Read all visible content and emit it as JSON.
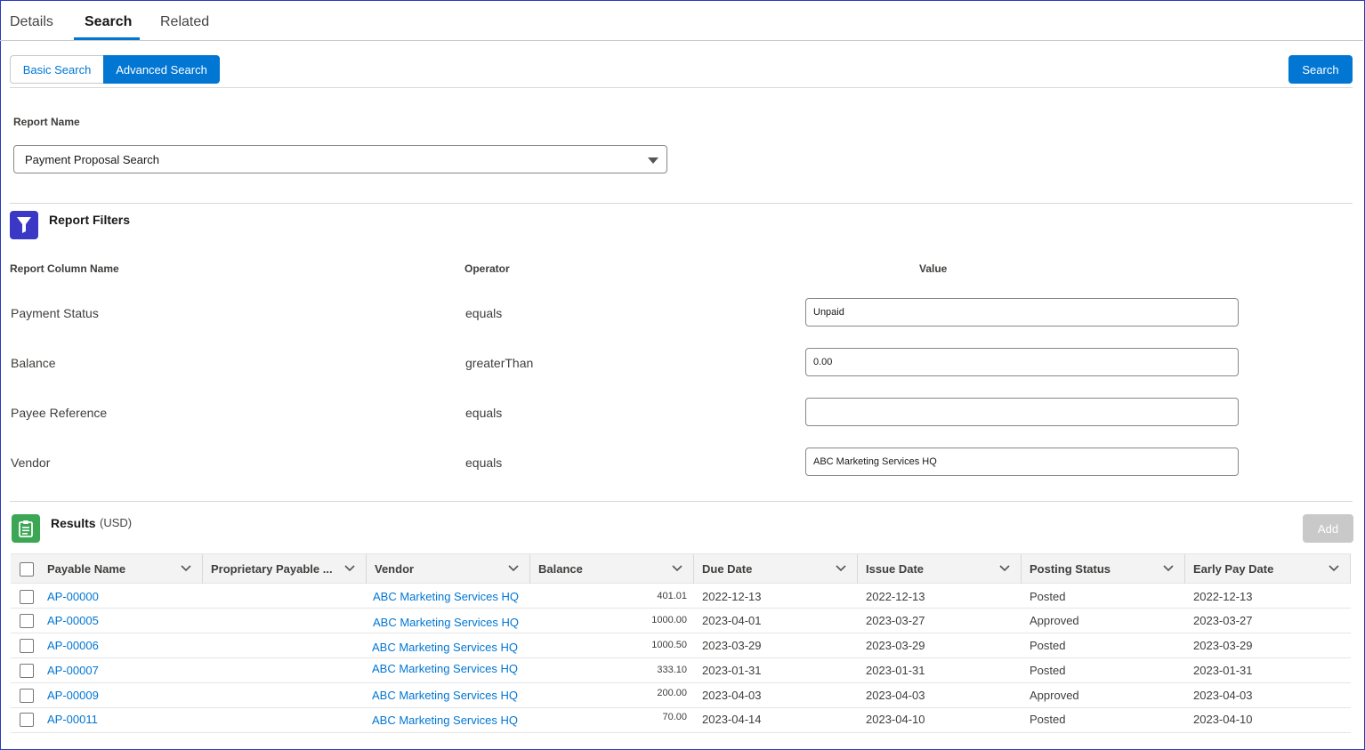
{
  "tabs": [
    {
      "label": "Details"
    },
    {
      "label": "Search"
    },
    {
      "label": "Related"
    }
  ],
  "search_mode": {
    "basic_label": "Basic Search",
    "advanced_label": "Advanced Search",
    "selected": "Advanced Search"
  },
  "search_button_label": "Search",
  "report_name": {
    "label": "Report Name",
    "selected_value": "Payment Proposal Search"
  },
  "filters": {
    "title": "Report Filters",
    "col_name_header": "Report Column Name",
    "operator_header": "Operator",
    "value_header": "Value",
    "rows": [
      {
        "column": "Payment Status",
        "operator": "equals",
        "value": "Unpaid"
      },
      {
        "column": "Balance",
        "operator": "greaterThan",
        "value": "0.00"
      },
      {
        "column": "Payee Reference",
        "operator": "equals",
        "value": ""
      },
      {
        "column": "Vendor",
        "operator": "equals",
        "value": "ABC Marketing Services HQ"
      }
    ]
  },
  "results": {
    "title": "Results",
    "currency": "(USD)",
    "add_label": "Add",
    "columns": [
      "Payable Name",
      "Proprietary Payable ...",
      "Vendor",
      "Balance",
      "Due Date",
      "Issue Date",
      "Posting Status",
      "Early Pay Date"
    ],
    "rows": [
      {
        "payable_name": "AP-00000",
        "proprietary": "",
        "vendor": "ABC Marketing Services HQ",
        "balance": "401.01",
        "due_date": "2022-12-13",
        "issue_date": "2022-12-13",
        "posting_status": "Posted",
        "early_pay_date": "2022-12-13"
      },
      {
        "payable_name": "AP-00005",
        "proprietary": "",
        "vendor": "ABC Marketing Services HQ",
        "balance": "1000.00",
        "due_date": "2023-04-01",
        "issue_date": "2023-03-27",
        "posting_status": "Approved",
        "early_pay_date": "2023-03-27"
      },
      {
        "payable_name": "AP-00006",
        "proprietary": "",
        "vendor": "ABC Marketing Services HQ",
        "balance": "1000.50",
        "due_date": "2023-03-29",
        "issue_date": "2023-03-29",
        "posting_status": "Posted",
        "early_pay_date": "2023-03-29"
      },
      {
        "payable_name": "AP-00007",
        "proprietary": "",
        "vendor": "ABC Marketing Services HQ",
        "balance": "333.10",
        "due_date": "2023-01-31",
        "issue_date": "2023-01-31",
        "posting_status": "Posted",
        "early_pay_date": "2023-01-31"
      },
      {
        "payable_name": "AP-00009",
        "proprietary": "",
        "vendor": "ABC Marketing Services HQ",
        "balance": "200.00",
        "due_date": "2023-04-03",
        "issue_date": "2023-04-03",
        "posting_status": "Approved",
        "early_pay_date": "2023-04-03"
      },
      {
        "payable_name": "AP-00011",
        "proprietary": "",
        "vendor": "ABC Marketing Services HQ",
        "balance": "70.00",
        "due_date": "2023-04-14",
        "issue_date": "2023-04-10",
        "posting_status": "Posted",
        "early_pay_date": "2023-04-10"
      }
    ]
  },
  "colors": {
    "brand": "#0176d3",
    "filter_icon_bg": "#3a38c5",
    "results_icon_bg": "#3ba755",
    "disabled_button": "#c9c9c9"
  },
  "icons": {
    "filter": "funnel-icon",
    "results": "clipboard-icon",
    "dropdown": "caret-down-icon",
    "column_menu": "chevron-down-icon"
  }
}
